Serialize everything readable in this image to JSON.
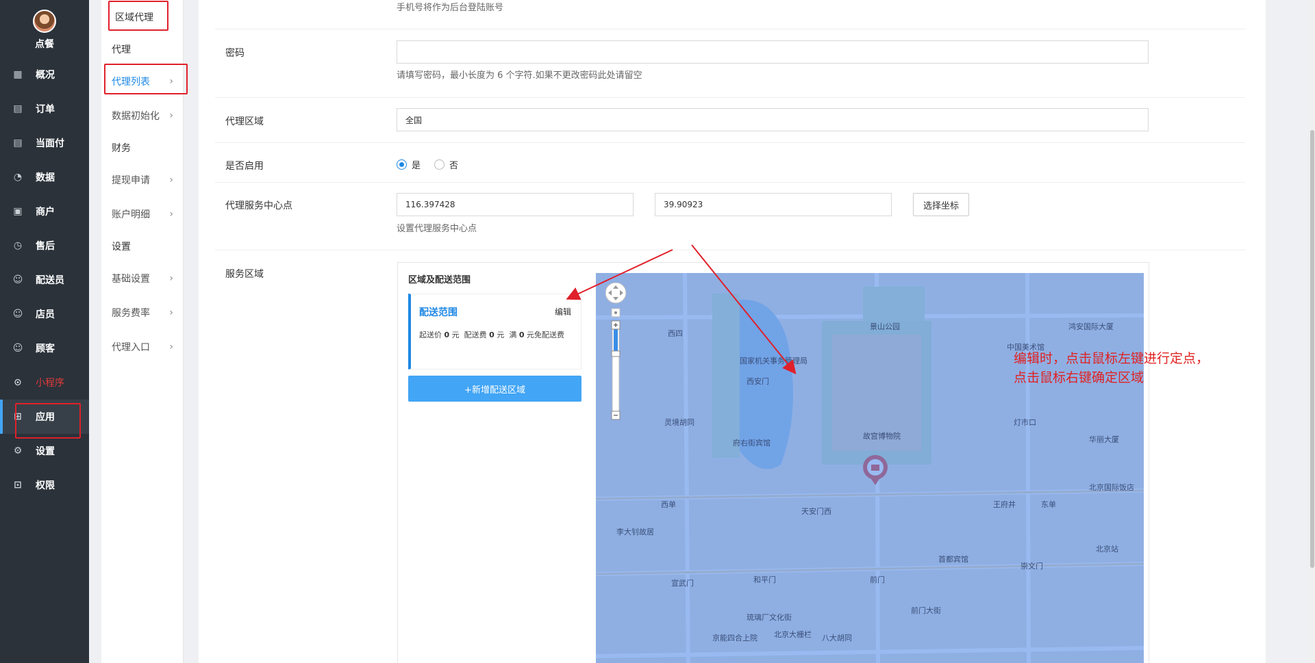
{
  "brand": {
    "name": "点餐"
  },
  "sidebar": {
    "items": [
      {
        "label": "概况",
        "icon": "overview-icon"
      },
      {
        "label": "订单",
        "icon": "order-icon"
      },
      {
        "label": "当面付",
        "icon": "pay-icon"
      },
      {
        "label": "数据",
        "icon": "chart-icon"
      },
      {
        "label": "商户",
        "icon": "store-icon"
      },
      {
        "label": "售后",
        "icon": "aftersale-icon"
      },
      {
        "label": "配送员",
        "icon": "courier-icon"
      },
      {
        "label": "店员",
        "icon": "staff-icon"
      },
      {
        "label": "顾客",
        "icon": "customer-icon"
      },
      {
        "label": "小程序",
        "icon": "miniapp-icon"
      },
      {
        "label": "应用",
        "icon": "apps-icon"
      },
      {
        "label": "设置",
        "icon": "gear-icon"
      },
      {
        "label": "权限",
        "icon": "lock-icon"
      }
    ],
    "active": "应用"
  },
  "subnav": {
    "header": "区域代理",
    "groups": [
      {
        "title": "代理",
        "items": [
          "代理列表",
          "数据初始化"
        ]
      },
      {
        "title": "财务",
        "items": [
          "提现申请",
          "账户明细"
        ]
      },
      {
        "title": "设置",
        "items": [
          "基础设置",
          "服务费率",
          "代理入口"
        ]
      }
    ],
    "active": "代理列表"
  },
  "form": {
    "phone_help": "手机号将作为后台登陆账号",
    "password": {
      "label": "密码",
      "value": "",
      "help": "请填写密码，最小长度为 6 个字符.如果不更改密码此处请留空"
    },
    "region": {
      "label": "代理区域",
      "value": "全国"
    },
    "enabled": {
      "label": "是否启用",
      "yes": "是",
      "no": "否",
      "selected": "是"
    },
    "center": {
      "label": "代理服务中心点",
      "lng": "116.397428",
      "lat": "39.90923",
      "button": "选择坐标",
      "help": "设置代理服务中心点"
    },
    "service_area": {
      "label": "服务区域",
      "box_title": "区域及配送范围",
      "card_title": "配送范围",
      "card_edit": "编辑",
      "min_price_label": "起送价",
      "min_price": "0",
      "fee_label": "配送费",
      "fee": "0",
      "free_label": "满",
      "free_over": "0",
      "free_suffix": "元免配送费",
      "unit": "元",
      "add_button": "+新增配送区域"
    }
  },
  "map": {
    "labels": [
      "国家机关事务管理局",
      "西四",
      "西安门",
      "灵境胡同",
      "府右街宾馆",
      "西单",
      "天安门西",
      "李大钊故居",
      "和平门",
      "宣武门",
      "琉璃厂文化街",
      "北京大栅栏",
      "前门",
      "首都宾馆",
      "前门大街",
      "崇文门",
      "王府井",
      "东单",
      "灯市口",
      "华丽大厦",
      "北京国际饭店",
      "北京站",
      "中国美术馆",
      "鸿安国际大厦",
      "景山公园",
      "故宫博物院",
      "京能四合上院",
      "八大胡同"
    ]
  },
  "annotation": {
    "line1": "编辑时，点击鼠标左键进行定点，",
    "line2": "点击鼠标右键确定区域"
  }
}
